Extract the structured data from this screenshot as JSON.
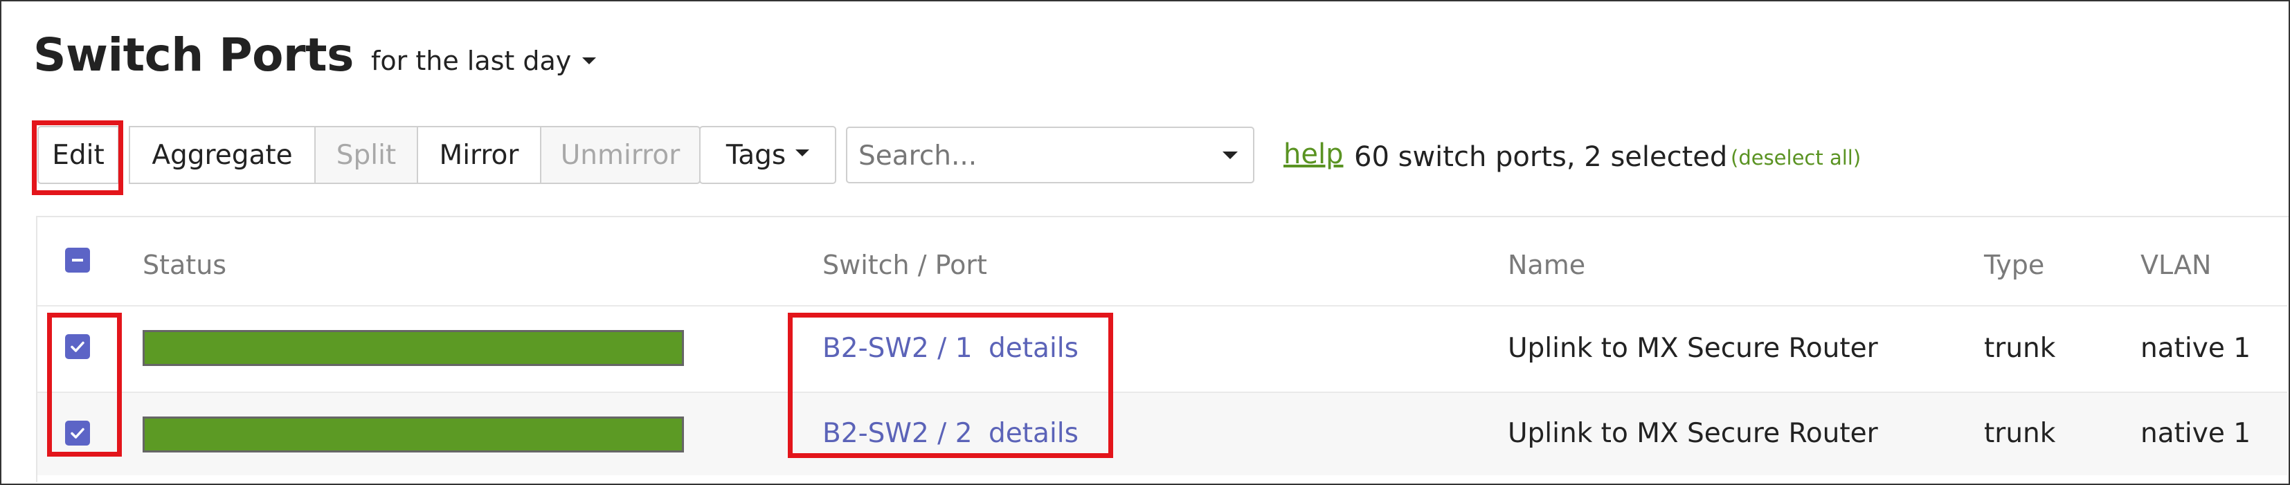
{
  "header": {
    "title": "Switch Ports",
    "timespan": "for the last day"
  },
  "toolbar": {
    "edit": "Edit",
    "aggregate": "Aggregate",
    "split": "Split",
    "mirror": "Mirror",
    "unmirror": "Unmirror",
    "tags": "Tags",
    "search_placeholder": "Search...",
    "help": "help",
    "count": "60 switch ports, 2 selected",
    "deselect": "(deselect all)"
  },
  "table": {
    "columns": {
      "status": "Status",
      "switch_port": "Switch / Port",
      "name": "Name",
      "type": "Type",
      "vlan": "VLAN"
    },
    "rows": [
      {
        "switch_port": "B2-SW2 / 1",
        "details": "details",
        "name": "Uplink to MX Secure Router",
        "type": "trunk",
        "vlan": "native 1",
        "selected": true,
        "status_fill": 1.0
      },
      {
        "switch_port": "B2-SW2 / 2",
        "details": "details",
        "name": "Uplink to MX Secure Router",
        "type": "trunk",
        "vlan": "native 1",
        "selected": true,
        "status_fill": 1.0
      }
    ]
  },
  "colors": {
    "accent": "#5c64c6",
    "status_green": "#5c9a24",
    "link": "#5b63b8",
    "highlight": "#e3151b",
    "help_green": "#5a9322"
  }
}
